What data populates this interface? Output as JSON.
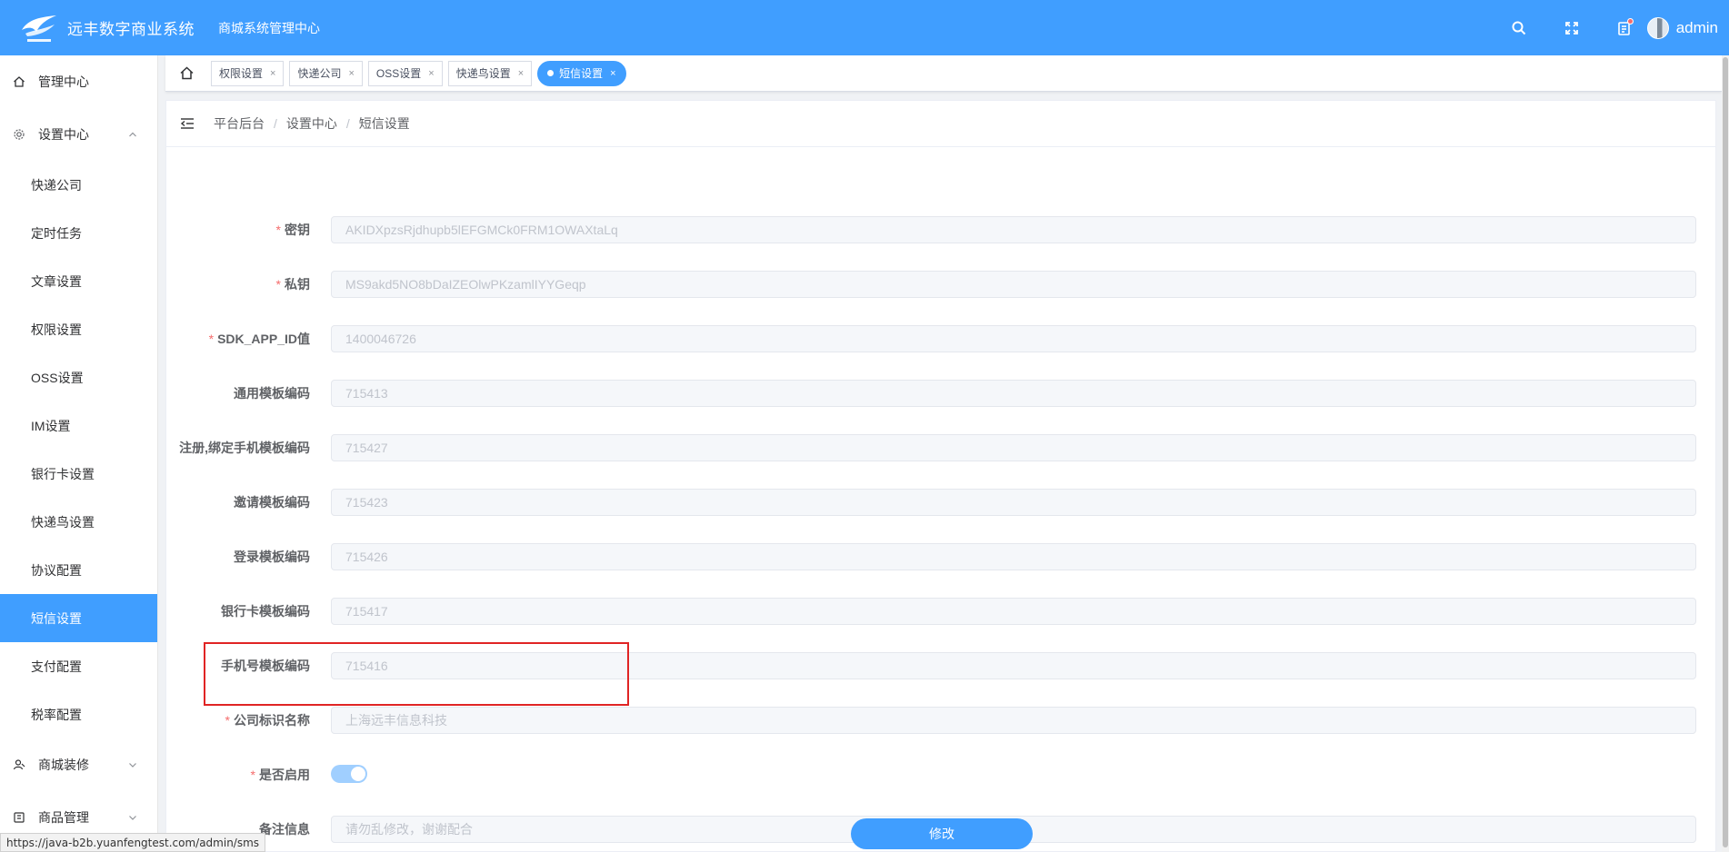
{
  "header": {
    "brand": "远丰数字商业系统",
    "subtitle": "商城系统管理中心",
    "username": "admin",
    "accent": "#409eff"
  },
  "sidebar": {
    "groups": [
      {
        "label": "管理中心",
        "icon": "home-icon"
      },
      {
        "label": "设置中心",
        "icon": "gear-icon"
      }
    ],
    "items": [
      "快递公司",
      "定时任务",
      "文章设置",
      "权限设置",
      "OSS设置",
      "IM设置",
      "银行卡设置",
      "快递鸟设置",
      "协议配置",
      "短信设置",
      "支付配置",
      "税率配置"
    ],
    "active_item": "短信设置",
    "groups_after": [
      {
        "label": "商城装修",
        "icon": "decor-icon"
      },
      {
        "label": "商品管理",
        "icon": "goods-icon"
      }
    ]
  },
  "tabs": [
    {
      "label": "权限设置",
      "close": "×"
    },
    {
      "label": "快递公司",
      "close": "×"
    },
    {
      "label": "OSS设置",
      "close": "×"
    },
    {
      "label": "快递鸟设置",
      "close": "×"
    },
    {
      "label": "短信设置",
      "close": "×"
    }
  ],
  "breadcrumb": [
    "平台后台",
    "设置中心",
    "短信设置"
  ],
  "form": {
    "fields": [
      {
        "label": "密钥",
        "required": true,
        "value": "AKIDXpzsRjdhupb5lEFGMCk0FRM1OWAXtaLq"
      },
      {
        "label": "私钥",
        "required": true,
        "value": "MS9akd5NO8bDaIZEOlwPKzamlIYYGeqp"
      },
      {
        "label": "SDK_APP_ID值",
        "required": true,
        "value": "1400046726"
      },
      {
        "label": "通用模板编码",
        "required": false,
        "value": "715413"
      },
      {
        "label": "注册,绑定手机模板编码",
        "required": false,
        "value": "715427"
      },
      {
        "label": "邀请模板编码",
        "required": false,
        "value": "715423"
      },
      {
        "label": "登录模板编码",
        "required": false,
        "value": "715426"
      },
      {
        "label": "银行卡模板编码",
        "required": false,
        "value": "715417"
      },
      {
        "label": "手机号模板编码",
        "required": false,
        "value": "715416"
      },
      {
        "label": "公司标识名称",
        "required": true,
        "value": "上海远丰信息科技"
      }
    ],
    "enable_label": "是否启用",
    "enabled": true,
    "remark_label": "备注信息",
    "remark_value": "请勿乱修改，谢谢配合",
    "required_mark": "*",
    "submit_label": "修改"
  },
  "statusbar": {
    "url": "https://java-b2b.yuanfengtest.com/admin/sms"
  }
}
